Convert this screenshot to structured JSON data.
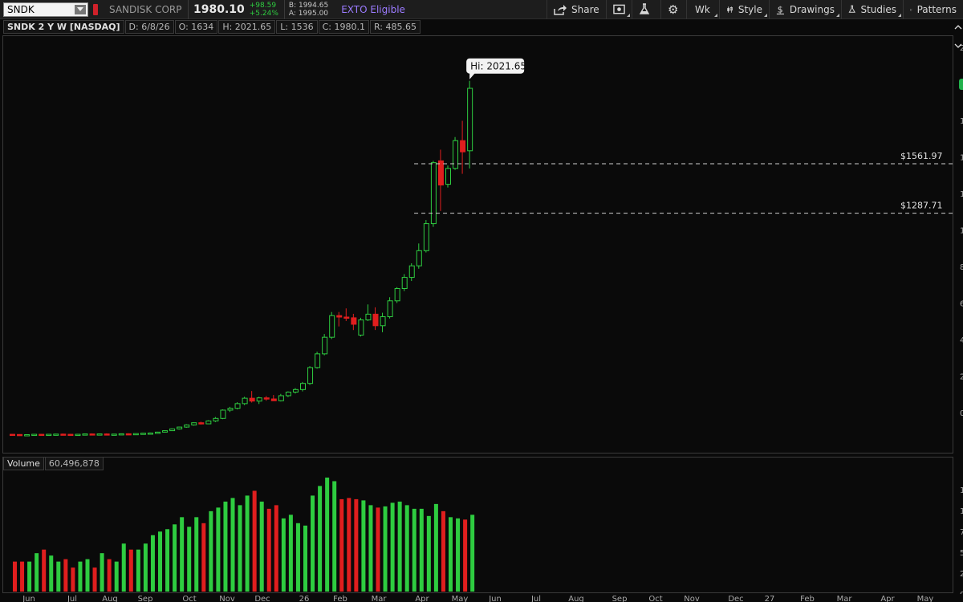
{
  "toolbar": {
    "symbol": "SNDK",
    "company": "SANDISK CORP",
    "last": "1980.10",
    "net_change": "+98.59",
    "pct_change": "+5.24%",
    "bid": "B: 1994.65",
    "ask": "A: 1995.00",
    "exto": "EXTO Eligible",
    "buttons": {
      "share": "Share",
      "wk": "Wk",
      "style": "Style",
      "drawings": "Drawings",
      "studies": "Studies",
      "patterns": "Patterns"
    },
    "icons": {
      "share": "share-icon",
      "snapshot": "snapshot-icon",
      "flask": "flask-icon",
      "gear": "gear-icon",
      "style": "candle-style-icon",
      "drawings": "dollar-drawing-icon",
      "studies": "studies-flask-icon",
      "patterns": "patterns-icon"
    }
  },
  "info": {
    "title": "SNDK 2 Y W [NASDAQ]",
    "date": "D: 6/8/26",
    "open": "O: 1634",
    "high": "H: 2021.65",
    "low": "L: 1536",
    "close": "C: 1980.1",
    "range": "R: 485.65"
  },
  "price_panel": {
    "hi_callout": "Hi: 2021.65",
    "price_levels": [
      {
        "value": 1561.97,
        "label": "$1561.97"
      },
      {
        "value": 1287.71,
        "label": "$1287.71"
      }
    ],
    "right_scale_ticks": [
      "2",
      "1",
      "1",
      "1",
      "1",
      "1",
      "8",
      "6",
      "4",
      "2",
      "0"
    ],
    "colors": {
      "up": "#2ecc40",
      "down": "#e01e1e",
      "level_line": "#d0d0d0",
      "badge": "#22b14c"
    }
  },
  "volume_panel": {
    "label": "Volume",
    "value": "60,496,878",
    "right_scale_ticks": [
      "1",
      "1",
      "7",
      "5",
      "2",
      "0"
    ]
  },
  "time_axis": [
    "Jun",
    "Jul",
    "Aug",
    "Sep",
    "Oct",
    "Nov",
    "Dec",
    "26",
    "Feb",
    "Mar",
    "Apr",
    "May",
    "Jun",
    "Jul",
    "Aug",
    "Sep",
    "Oct",
    "Nov",
    "Dec",
    "27",
    "Feb",
    "Mar",
    "Apr",
    "May"
  ],
  "chart_data": {
    "type": "candlestick",
    "ohlc": [
      [
        62,
        64,
        58,
        61
      ],
      [
        61,
        63,
        57,
        59
      ],
      [
        59,
        62,
        55,
        60
      ],
      [
        60,
        63,
        58,
        62
      ],
      [
        62,
        64,
        59,
        60
      ],
      [
        60,
        63,
        57,
        62
      ],
      [
        62,
        65,
        60,
        63
      ],
      [
        63,
        66,
        61,
        62
      ],
      [
        62,
        64,
        59,
        61
      ],
      [
        61,
        63,
        58,
        62
      ],
      [
        62,
        65,
        60,
        64
      ],
      [
        64,
        67,
        62,
        63
      ],
      [
        63,
        65,
        60,
        64
      ],
      [
        64,
        67,
        62,
        61
      ],
      [
        61,
        64,
        59,
        63
      ],
      [
        63,
        66,
        61,
        65
      ],
      [
        65,
        68,
        63,
        64
      ],
      [
        64,
        66,
        61,
        66
      ],
      [
        66,
        70,
        64,
        68
      ],
      [
        68,
        72,
        66,
        69
      ],
      [
        69,
        76,
        68,
        74
      ],
      [
        74,
        84,
        72,
        82
      ],
      [
        82,
        95,
        80,
        92
      ],
      [
        92,
        104,
        88,
        102
      ],
      [
        102,
        118,
        98,
        114
      ],
      [
        114,
        128,
        110,
        126
      ],
      [
        126,
        132,
        116,
        120
      ],
      [
        120,
        140,
        118,
        136
      ],
      [
        136,
        158,
        130,
        150
      ],
      [
        150,
        200,
        146,
        196
      ],
      [
        196,
        214,
        186,
        206
      ],
      [
        206,
        240,
        200,
        232
      ],
      [
        232,
        270,
        224,
        262
      ],
      [
        262,
        302,
        238,
        246
      ],
      [
        246,
        270,
        230,
        264
      ],
      [
        264,
        274,
        248,
        258
      ],
      [
        258,
        280,
        250,
        248
      ],
      [
        248,
        286,
        244,
        276
      ],
      [
        276,
        300,
        268,
        296
      ],
      [
        296,
        318,
        288,
        310
      ],
      [
        310,
        352,
        300,
        344
      ],
      [
        344,
        440,
        336,
        432
      ],
      [
        432,
        520,
        426,
        508
      ],
      [
        508,
        618,
        500,
        600
      ],
      [
        600,
        740,
        590,
        720
      ],
      [
        720,
        740,
        660,
        712
      ],
      [
        712,
        760,
        690,
        708
      ],
      [
        708,
        730,
        640,
        672
      ],
      [
        612,
        708,
        604,
        696
      ],
      [
        696,
        782,
        690,
        728
      ],
      [
        728,
        766,
        640,
        664
      ],
      [
        664,
        736,
        628,
        714
      ],
      [
        714,
        822,
        704,
        802
      ],
      [
        802,
        878,
        790,
        870
      ],
      [
        870,
        950,
        856,
        932
      ],
      [
        932,
        1010,
        912,
        996
      ],
      [
        996,
        1120,
        980,
        1080
      ],
      [
        1080,
        1250,
        1070,
        1230
      ],
      [
        1230,
        1578,
        1212,
        1568
      ],
      [
        1578,
        1640,
        1300,
        1444
      ],
      [
        1448,
        1552,
        1430,
        1536
      ],
      [
        1536,
        1710,
        1528,
        1690
      ],
      [
        1690,
        1800,
        1506,
        1628
      ],
      [
        1634,
        2021.65,
        1536,
        1980.1
      ]
    ],
    "volume_millions": [
      25,
      25,
      25,
      32,
      35,
      30,
      25,
      27,
      20,
      25,
      27,
      20,
      32,
      27,
      25,
      40,
      35,
      35,
      40,
      47,
      50,
      52,
      56,
      62,
      54,
      62,
      57,
      67,
      70,
      75,
      78,
      72,
      80,
      84,
      75,
      69,
      72,
      61,
      64,
      57,
      55,
      80,
      88,
      95,
      92,
      77,
      78,
      77,
      76,
      72,
      70,
      71,
      74,
      75,
      72,
      69,
      69,
      63,
      73,
      67,
      62,
      61,
      60,
      64
    ],
    "volume_current": 60496878,
    "ylim": [
      0,
      2100
    ]
  }
}
